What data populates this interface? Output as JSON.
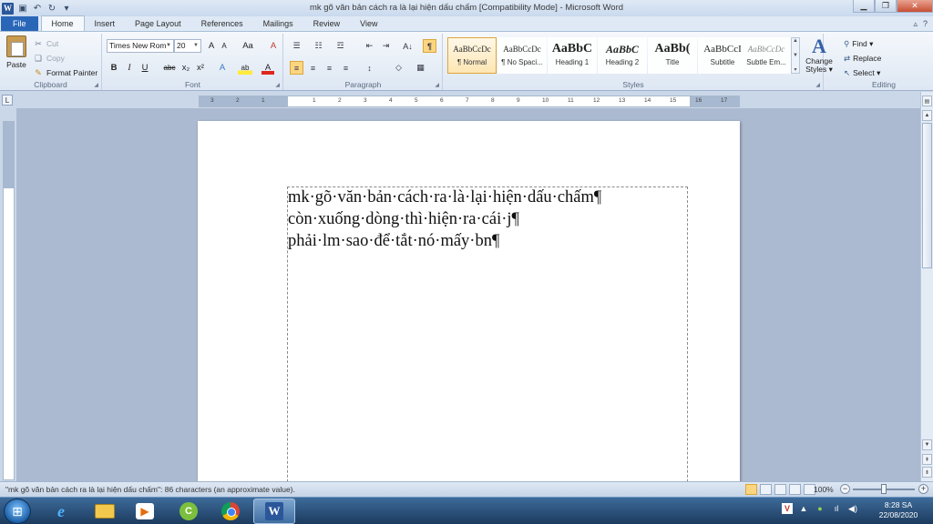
{
  "window": {
    "title": "mk gõ văn bản cách ra là lại hiện dấu chấm [Compatibility Mode]  -  Microsoft Word",
    "app_icon": "W",
    "minimize": "▁",
    "restore": "❐",
    "close": "✕"
  },
  "tabs": [
    {
      "label": "File"
    },
    {
      "label": "Home"
    },
    {
      "label": "Insert"
    },
    {
      "label": "Page Layout"
    },
    {
      "label": "References"
    },
    {
      "label": "Mailings"
    },
    {
      "label": "Review"
    },
    {
      "label": "View"
    }
  ],
  "tab_right": {
    "minimize_ribbon": "▵",
    "help": "?"
  },
  "clipboard": {
    "paste": "Paste",
    "cut": "Cut",
    "copy": "Copy",
    "format_painter": "Format Painter",
    "label": "Clipboard"
  },
  "font": {
    "name": "Times New Rom",
    "size": "20",
    "grow": "A",
    "shrink": "A",
    "case": "Aa",
    "clear": "A",
    "bold": "B",
    "italic": "I",
    "underline": "U",
    "strike": "abc",
    "subscript": "x₂",
    "superscript": "x²",
    "effects": "A",
    "highlight": "ab",
    "color": "A",
    "label": "Font"
  },
  "paragraph": {
    "bullets": "☰",
    "numbering": "☷",
    "multilevel": "☲",
    "decrease_indent": "⇤",
    "increase_indent": "⇥",
    "sort": "A↓",
    "show_marks": "¶",
    "align_left": "≡",
    "center": "≡",
    "align_right": "≡",
    "justify": "≡",
    "line_spacing": "↕",
    "shading": "◇",
    "borders": "▦",
    "label": "Paragraph"
  },
  "styles": {
    "items": [
      {
        "sample": "AaBbCcDc",
        "name": "¶ Normal"
      },
      {
        "sample": "AaBbCcDc",
        "name": "¶ No Spaci..."
      },
      {
        "sample": "AaBbC",
        "name": "Heading 1"
      },
      {
        "sample": "AaBbC",
        "name": "Heading 2"
      },
      {
        "sample": "AaBb(",
        "name": "Title"
      },
      {
        "sample": "AaBbCcI",
        "name": "Subtitle"
      },
      {
        "sample": "AaBbCcDc",
        "name": "Subtle Em..."
      }
    ],
    "change_styles_line1": "Change",
    "change_styles_line2": "Styles ▾",
    "label": "Styles"
  },
  "editing": {
    "find": "Find ▾",
    "replace": "Replace",
    "select": "Select ▾",
    "label": "Editing"
  },
  "ruler": {
    "corner": "L",
    "numbers": [
      "3",
      "2",
      "1",
      "1",
      "2",
      "3",
      "4",
      "5",
      "6",
      "7",
      "8",
      "9",
      "10",
      "11",
      "12",
      "13",
      "14",
      "15",
      "16",
      "17"
    ]
  },
  "document": {
    "lines": [
      "mk·gõ·văn·bản·cách·ra·là·lại·hiện·dấu·chấm¶",
      "còn·xuống·dòng·thì·hiện·ra·cái·j¶",
      "phải·lm·sao·để·tắt·nó·mấy·bn¶"
    ]
  },
  "status": {
    "text": "\"mk gõ văn bản cách ra là lại hiện dấu chấm\": 86 characters (an approximate value).",
    "zoom": "100%",
    "zoom_level": 1.0,
    "zoom_minus": "−",
    "zoom_plus": "+"
  },
  "taskbar": {
    "start": "⊞",
    "ie_glyph": "e",
    "media_glyph": "▶",
    "coccoc_glyph": "C",
    "word_glyph": "W",
    "tray": {
      "antivirus": "V",
      "network": "▲",
      "signal": "ıl",
      "volume": "◀)"
    },
    "time": "8:28 SA",
    "date": "22/08/2020"
  }
}
